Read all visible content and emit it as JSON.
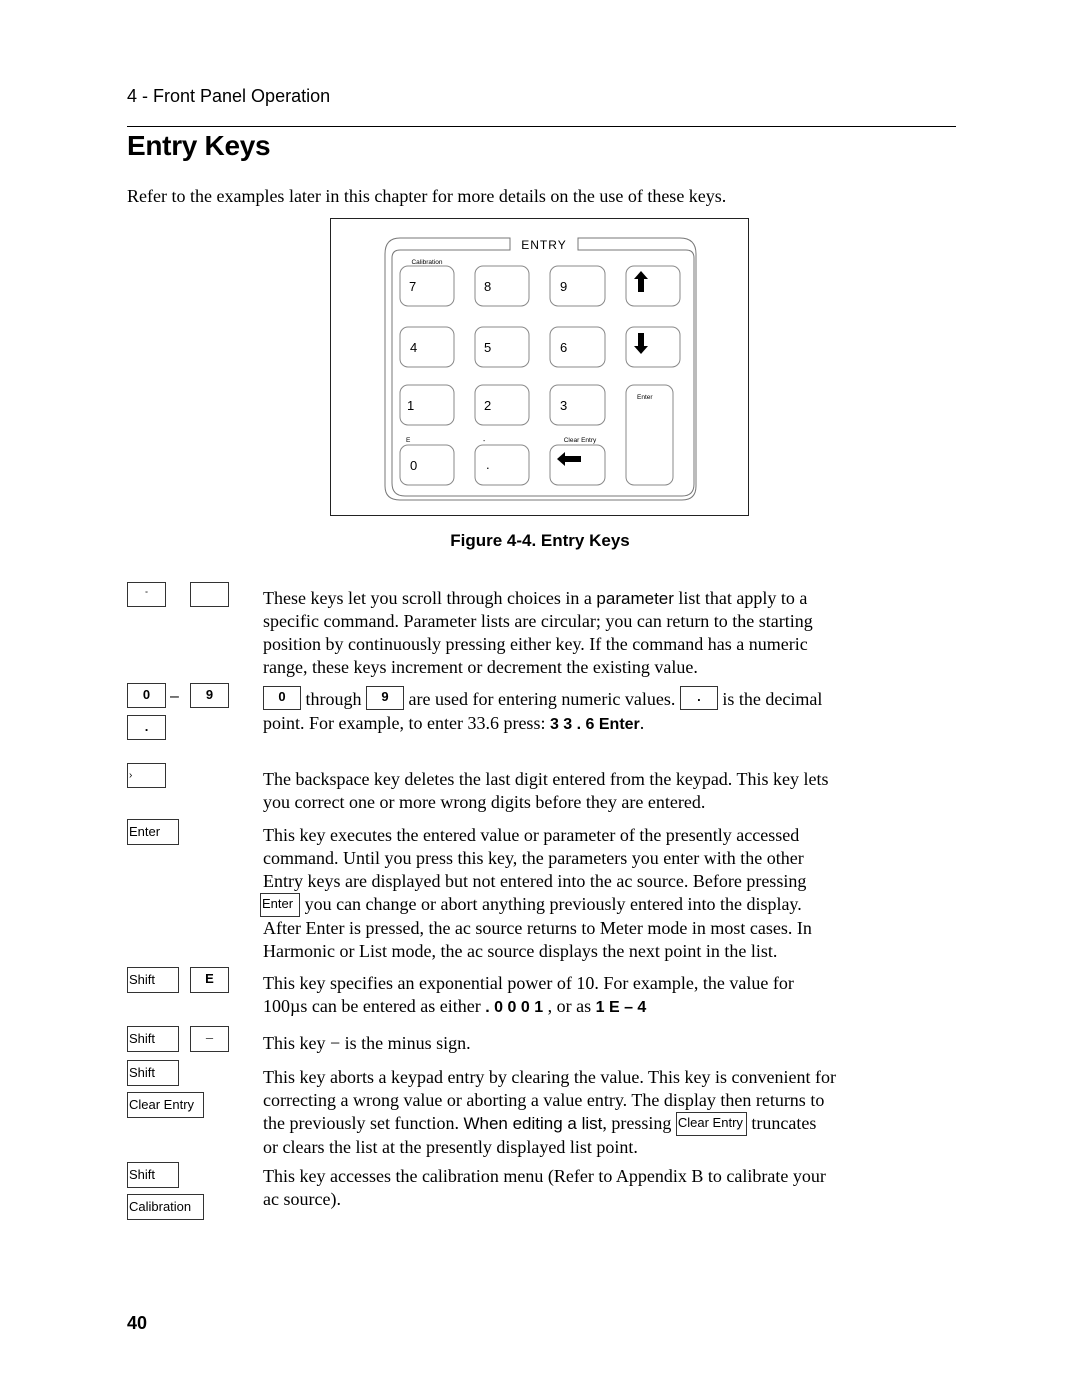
{
  "header": {
    "chapter": "4 - Front Panel Operation",
    "title": "Entry Keys",
    "intro": "Refer to the examples later in this chapter for more details on the use of these keys."
  },
  "figure": {
    "panel_label": "ENTRY",
    "caption": "Figure 4-4. Entry Keys",
    "keys": [
      {
        "label": "7",
        "shift_label": "Calibration"
      },
      {
        "label": "8",
        "shift_label": ""
      },
      {
        "label": "9",
        "shift_label": ""
      },
      {
        "label": "up-arrow",
        "shift_label": ""
      },
      {
        "label": "4",
        "shift_label": ""
      },
      {
        "label": "5",
        "shift_label": ""
      },
      {
        "label": "6",
        "shift_label": ""
      },
      {
        "label": "down-arrow",
        "shift_label": ""
      },
      {
        "label": "1",
        "shift_label": ""
      },
      {
        "label": "2",
        "shift_label": ""
      },
      {
        "label": "3",
        "shift_label": ""
      },
      {
        "label": "Enter",
        "shift_label": ""
      },
      {
        "label": "0",
        "shift_label": "E"
      },
      {
        "label": ".",
        "shift_label": "-"
      },
      {
        "label": "backspace-arrow",
        "shift_label": "Clear Entry"
      }
    ]
  },
  "entries": [
    {
      "keys": {
        "up": "↑",
        "down": ""
      },
      "lines": [
        [
          "These keys let you scroll through choices in a ",
          "parameter",
          " list that apply to a"
        ],
        "specific command. Parameter lists are circular; you can return to the starting",
        "position by continuously pressing either key. If the command has a numeric",
        "range, these keys increment or decrement the existing value."
      ]
    },
    {
      "keys": {
        "first": "0",
        "range_sep": "–",
        "last": "9",
        "decimal": "."
      },
      "line1": {
        "key_a": "0",
        "t1": " through ",
        "key_b": "9",
        "t2": " are used for entering numeric values. ",
        "key_c": ".",
        "t3": " is the decimal"
      },
      "line2": {
        "t1": "point. For example, to enter 33.6 press:  ",
        "seq": "3 3 . 6  Enter",
        "t2": "."
      }
    },
    {
      "keys": {
        "backspace": "›"
      },
      "lines": [
        "The backspace key deletes the last digit entered from the keypad. This key lets",
        "you correct one or more wrong digits before they are entered."
      ]
    },
    {
      "keys": {
        "enter": "Enter"
      },
      "lines": [
        "This key executes the entered value or parameter of the presently accessed",
        "command. Until you press this key, the parameters you enter with the other",
        "Entry keys are displayed but not entered into the ac source. Before pressing"
      ],
      "inline_key": "Enter",
      "inline_rest": " you can change or abort anything previously entered into the display.",
      "more_lines": [
        "After Enter is pressed, the ac source returns to Meter mode in most cases. In",
        "Harmonic or List mode, the ac source displays the next point in the list."
      ]
    },
    {
      "keys": {
        "shift": "Shift",
        "key": "E"
      },
      "line1": "This key specifies an exponential power of 10. For example, the value for",
      "line2": {
        "t1": "100µs can be entered as either ",
        "seq1": ". 0 0 0 1",
        "t2": " , or as ",
        "seq2": "1 E – 4"
      }
    },
    {
      "keys": {
        "shift": "Shift",
        "key": "–"
      },
      "text": "This key  −  is the minus sign."
    },
    {
      "keys": {
        "shift": "Shift",
        "key": "Clear Entry"
      },
      "lines": [
        "This key aborts a keypad entry by clearing the value. This key is convenient for",
        "correcting a wrong value or aborting a value entry. The display then returns to"
      ],
      "line3": {
        "t1": "the previously set function. ",
        "sans": "When editing a list",
        "t2": ", pressing ",
        "key": "Clear Entry",
        "t3": " truncates"
      },
      "line4": "or clears the list at the presently displayed list point."
    },
    {
      "keys": {
        "shift": "Shift",
        "key": "Calibration"
      },
      "lines": [
        "This key accesses the calibration menu (Refer to Appendix B to calibrate your",
        "ac source)."
      ]
    }
  ],
  "footer": {
    "page_number": "40"
  }
}
